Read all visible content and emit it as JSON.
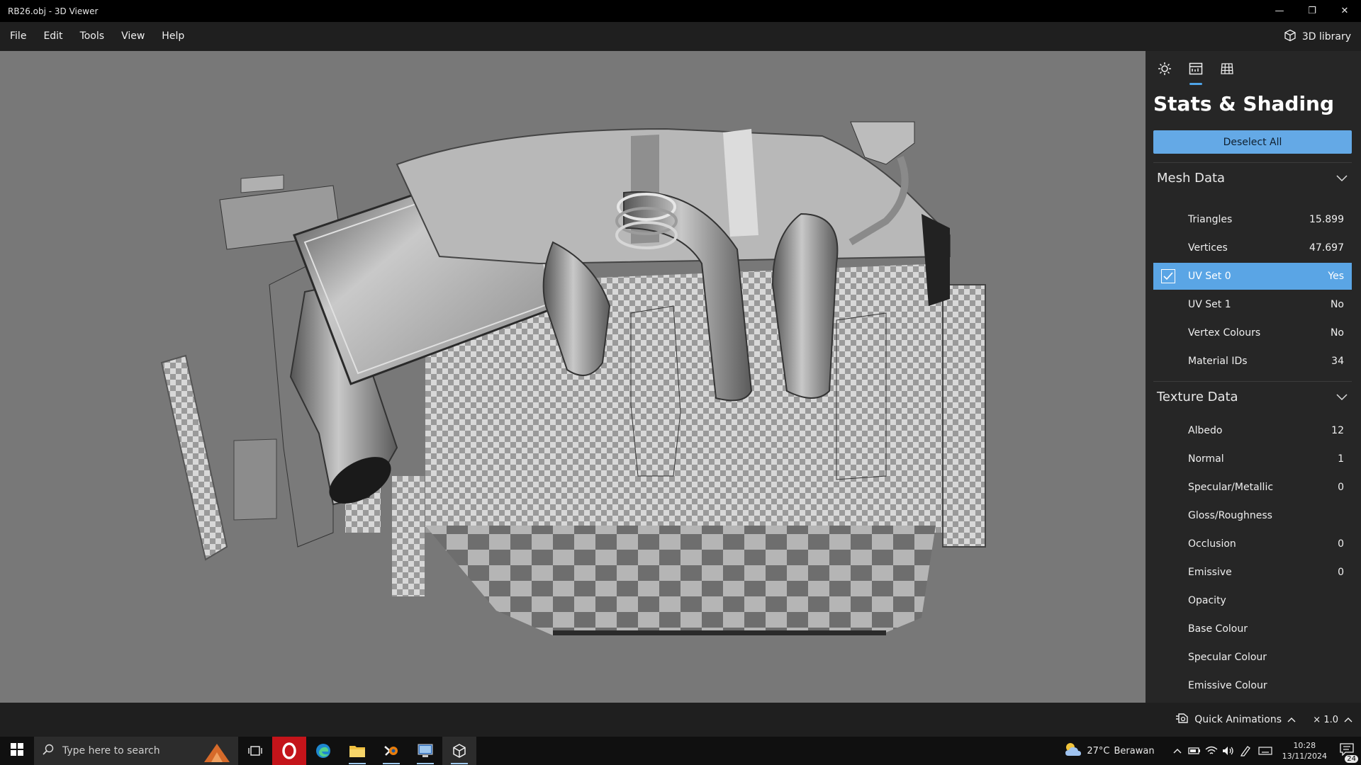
{
  "window": {
    "title": "RB26.obj - 3D Viewer",
    "controls": {
      "minimize": "—",
      "restore": "❐",
      "close": "✕"
    }
  },
  "menu": {
    "items": [
      "File",
      "Edit",
      "Tools",
      "View",
      "Help"
    ],
    "library_button": "3D library",
    "library_icon": "cube-icon"
  },
  "panel": {
    "tabs": [
      {
        "name": "lighting",
        "icon": "sun-icon"
      },
      {
        "name": "stats",
        "icon": "stats-icon",
        "active": true
      },
      {
        "name": "grid",
        "icon": "grid-icon"
      }
    ],
    "title": "Stats & Shading",
    "deselect_label": "Deselect All",
    "mesh_section": {
      "title": "Mesh Data",
      "rows": [
        {
          "label": "Triangles",
          "value": "15.899"
        },
        {
          "label": "Vertices",
          "value": "47.697"
        },
        {
          "label": "UV Set 0",
          "value": "Yes",
          "selected": true,
          "checked": true
        },
        {
          "label": "UV Set 1",
          "value": "No"
        },
        {
          "label": "Vertex Colours",
          "value": "No"
        },
        {
          "label": "Material IDs",
          "value": "34"
        }
      ]
    },
    "texture_section": {
      "title": "Texture Data",
      "rows": [
        {
          "label": "Albedo",
          "value": "12"
        },
        {
          "label": "Normal",
          "value": "1"
        },
        {
          "label": "Specular/Metallic",
          "value": "0"
        },
        {
          "label": "Gloss/Roughness",
          "value": ""
        },
        {
          "label": "Occlusion",
          "value": "0"
        },
        {
          "label": "Emissive",
          "value": "0"
        },
        {
          "label": "Opacity",
          "value": ""
        },
        {
          "label": "Base Colour",
          "value": ""
        },
        {
          "label": "Specular Colour",
          "value": ""
        },
        {
          "label": "Emissive Colour",
          "value": ""
        }
      ]
    }
  },
  "status": {
    "quick_animations": "Quick Animations",
    "speed": "× 1.0"
  },
  "taskbar": {
    "search_placeholder": "Type here to search",
    "apps": [
      "task-view-icon",
      "opera-icon",
      "edge-icon",
      "file-explorer-icon",
      "blender-icon",
      "remote-desktop-icon",
      "3d-viewer-icon"
    ],
    "weather": {
      "temp": "27°C",
      "text": "Berawan"
    },
    "time": "10:28",
    "date": "13/11/2024",
    "notifications": "24"
  },
  "colors": {
    "accent": "#64a9e6",
    "selection": "#5aa5e5",
    "viewport_bg": "#787878",
    "panel_bg": "#262626"
  }
}
